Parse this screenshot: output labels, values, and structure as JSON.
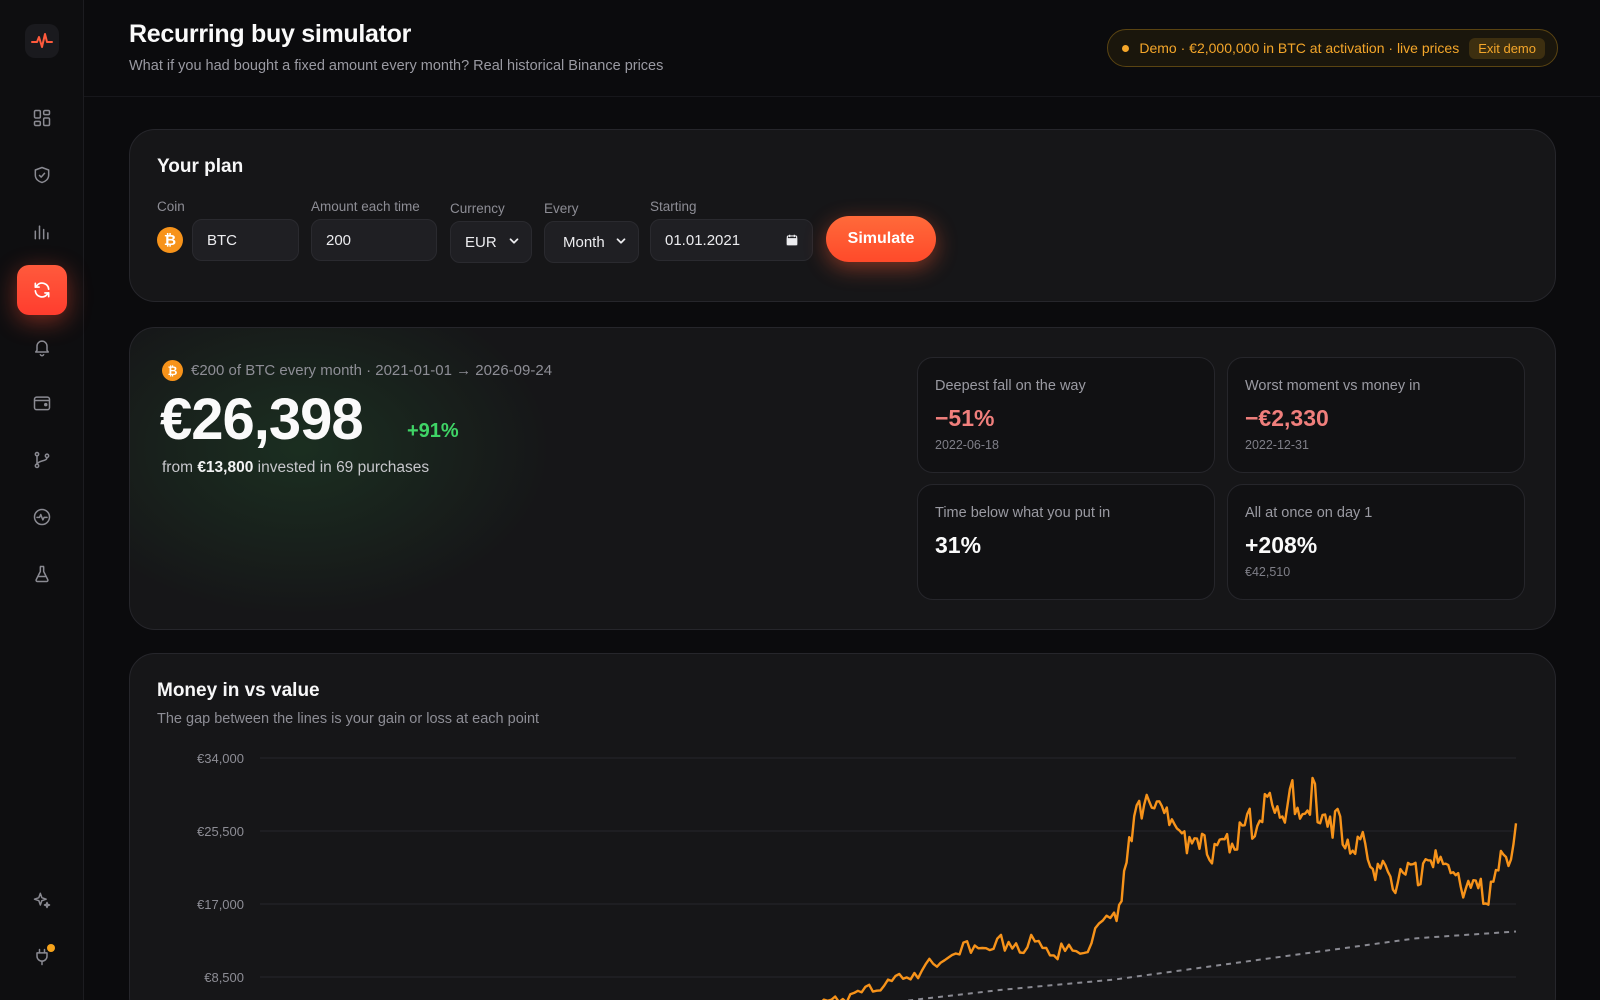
{
  "header": {
    "title": "Recurring buy simulator",
    "subtitle": "What if you had bought a fixed amount every month? Real historical Binance prices",
    "demo_text": "Demo · €2,000,000 in BTC at activation · live prices",
    "exit_demo": "Exit demo"
  },
  "sidebar": {
    "items": [
      {
        "icon": "dashboard-icon"
      },
      {
        "icon": "shield-icon"
      },
      {
        "icon": "bar-chart-icon"
      },
      {
        "icon": "refresh-icon",
        "active": true
      },
      {
        "icon": "bell-icon"
      },
      {
        "icon": "wallet-icon"
      },
      {
        "icon": "branch-icon"
      },
      {
        "icon": "pulse-icon"
      },
      {
        "icon": "flask-icon"
      },
      {
        "icon": "sparkle-icon"
      },
      {
        "icon": "plug-icon",
        "badge": true
      }
    ]
  },
  "plan": {
    "title": "Your plan",
    "coin_label": "Coin",
    "coin_symbol": "₿",
    "coin_value": "BTC",
    "amount_label": "Amount each time",
    "amount_value": "200",
    "currency_label": "Currency",
    "currency_value": "EUR",
    "every_label": "Every",
    "every_value": "Month",
    "starting_label": "Starting",
    "starting_value": "01.01.2021",
    "simulate": "Simulate"
  },
  "result": {
    "summary": "€200 of BTC every month · 2021-01-01 → 2026-09-24",
    "value": "€26,398",
    "gain_pct": "+91%",
    "invested_prefix": "from",
    "invested_amount": "€13,800",
    "invested_suffix": "invested in 69 purchases",
    "stats": [
      {
        "label": "Deepest fall on the way",
        "value": "−51%",
        "sub": "2022-06-18",
        "tone": "neg"
      },
      {
        "label": "Worst moment vs money in",
        "value": "−€2,330",
        "sub": "2022-12-31",
        "tone": "neg"
      },
      {
        "label": "Time below what you put in",
        "value": "31%",
        "sub": "",
        "tone": "pos"
      },
      {
        "label": "All at once on day 1",
        "value": "+208%",
        "sub": "€42,510",
        "tone": "pos"
      }
    ]
  },
  "chart": {
    "title": "Money in vs value",
    "subtitle": "The gap between the lines is your gain or loss at each point",
    "colors": {
      "value": "#f7931a",
      "invested": "#8a8a92"
    }
  },
  "chart_data": {
    "type": "line",
    "x": [
      0,
      0.04,
      0.08,
      0.12,
      0.16,
      0.2,
      0.24,
      0.28,
      0.32,
      0.36,
      0.4,
      0.44,
      0.47,
      0.5,
      0.53,
      0.56,
      0.59,
      0.62,
      0.65,
      0.68,
      0.7,
      0.72,
      0.74,
      0.76,
      0.78,
      0.8,
      0.82,
      0.84,
      0.86,
      0.88,
      0.9,
      0.92,
      0.94,
      0.96,
      0.98,
      1.0
    ],
    "series": [
      {
        "values": [
          200,
          500,
          900,
          1300,
          1700,
          2100,
          2500,
          3000,
          3400,
          3700,
          4300,
          5300,
          6500,
          8200,
          10000,
          12500,
          13400,
          12700,
          11500,
          16000,
          29000,
          27600,
          24800,
          24000,
          26500,
          29800,
          30400,
          31000,
          27200,
          24000,
          20200,
          21800,
          22500,
          18800,
          19600,
          26398
        ]
      },
      {
        "values": [
          200,
          600,
          1000,
          1400,
          1800,
          2200,
          2600,
          3000,
          3400,
          3800,
          4200,
          4600,
          5000,
          5500,
          6000,
          6500,
          7000,
          7400,
          7800,
          8200,
          8600,
          9000,
          9400,
          9800,
          10200,
          10600,
          11000,
          11400,
          11800,
          12200,
          12600,
          13000,
          13200,
          13400,
          13600,
          13800
        ]
      }
    ],
    "y_ticks": [
      "€34,000",
      "€25,500",
      "€17,000",
      "€8,500"
    ],
    "ylim": [
      0,
      34000
    ],
    "grid": true
  }
}
